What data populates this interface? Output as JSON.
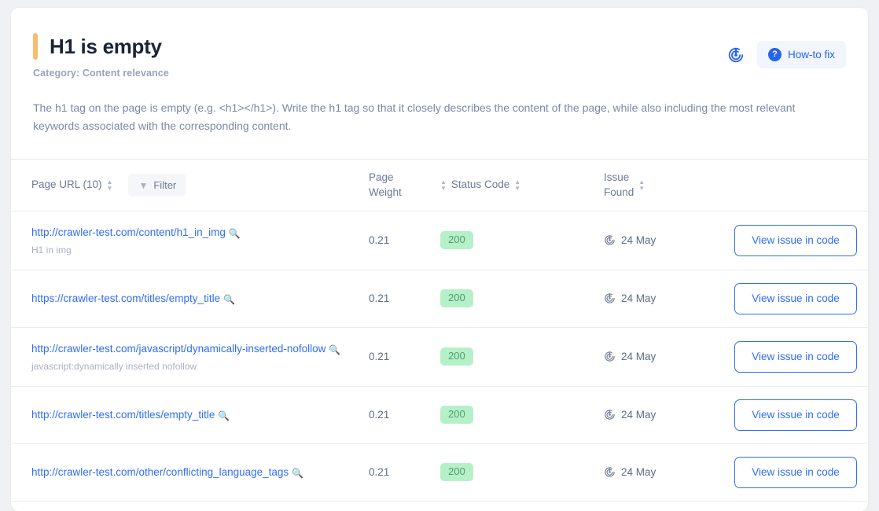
{
  "header": {
    "title": "H1 is empty",
    "category": "Category: Content relevance",
    "radar_icon": "radar-icon",
    "howto_label": "How-to fix",
    "howto_icon": "question-mark-icon",
    "accent_color": "#f7bc70"
  },
  "description": "The h1 tag on the page is empty (e.g. <h1></h1>). Write the h1 tag so that it closely describes the content of the page, while also including the most relevant keywords associated with the corresponding content.",
  "table": {
    "columns": {
      "url": "Page URL (10)",
      "weight": "Page\nWeight",
      "status": "Status Code",
      "issue": "Issue\nFound"
    },
    "filter_label": "Filter",
    "action_label": "View issue in code",
    "rows": [
      {
        "url": "http://crawler-test.com/content/h1_in_img",
        "subtitle": "H1 in img",
        "weight": "0.21",
        "status": "200",
        "issue_found": "24 May",
        "action": "View issue in code"
      },
      {
        "url": "https://crawler-test.com/titles/empty_title",
        "subtitle": "",
        "weight": "0.21",
        "status": "200",
        "issue_found": "24 May",
        "action": "View issue in code"
      },
      {
        "url": "http://crawler-test.com/javascript/dynamically-inserted-nofollow",
        "subtitle": "javascript:dynamically inserted nofollow",
        "weight": "0.21",
        "status": "200",
        "issue_found": "24 May",
        "action": "View issue in code"
      },
      {
        "url": "http://crawler-test.com/titles/empty_title",
        "subtitle": "",
        "weight": "0.21",
        "status": "200",
        "issue_found": "24 May",
        "action": "View issue in code"
      },
      {
        "url": "http://crawler-test.com/other/conflicting_language_tags",
        "subtitle": "",
        "weight": "0.21",
        "status": "200",
        "issue_found": "24 May",
        "action": "View issue in code"
      }
    ]
  },
  "colors": {
    "link": "#2f6df6",
    "status_bg": "#b6f0c9",
    "status_text": "#4c9e6c",
    "page_bg": "#f0f1f5"
  }
}
